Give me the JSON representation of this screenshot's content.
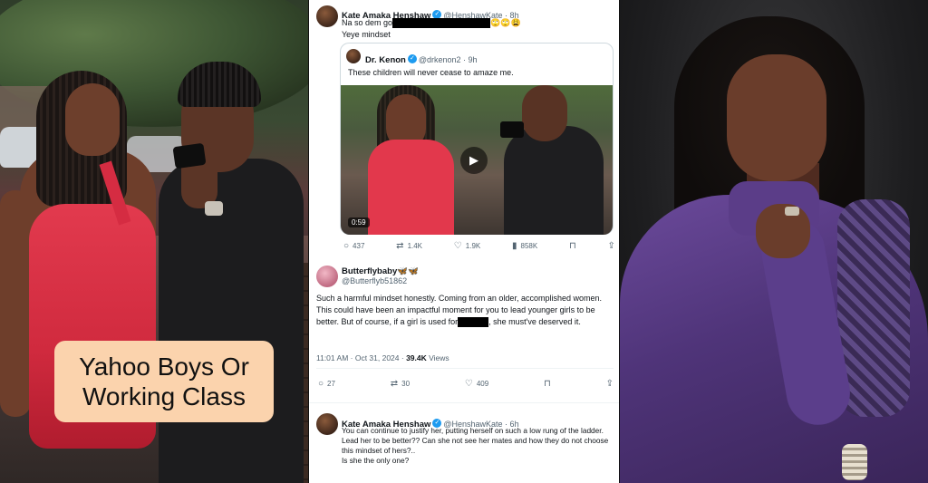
{
  "caption": {
    "line1": "Yahoo Boys Or",
    "line2": "Working Class",
    "background": "#fbd3ad"
  },
  "tweet1": {
    "name": "Kate Amaka Henshaw",
    "handle": "@HenshawKate · 8h",
    "text_prefix": "Na so dem go",
    "text_suffix": "🙄🙄😩",
    "line2": "Yeye mindset"
  },
  "quoted": {
    "name": "Dr. Kenon",
    "handle": "@drkenon2 · 9h",
    "text": "These children will never cease to amaze me.",
    "duration": "0:59",
    "replies": "437",
    "retweets": "1.4K",
    "likes": "1.9K",
    "views": "858K"
  },
  "tweet2": {
    "name": "Butterflybaby🦋🦋",
    "handle": "@Butterflyb51862",
    "text1": "Such a harmful mindset honestly. Coming from an older, accomplished women. This could have been an impactful moment for you to lead younger girls to be better. But of course, if a girl is used for",
    "text2": "she must've deserved it.",
    "time": "11:01 AM · Oct 31, 2024 · ",
    "views": "39.4K",
    "views_label": "Views",
    "replies": "27",
    "retweets": "30",
    "likes": "409"
  },
  "tweet3": {
    "name": "Kate Amaka Henshaw",
    "handle": "@HenshawKate · 6h",
    "line1": "You can continue to justify her, putting herself on such a low rung of the ladder.",
    "line2": "Lead her to be better?? Can she not see her mates and how they do not choose this mindset of hers?..",
    "line3": "Is she the only one?"
  },
  "colors": {
    "verified": "#1d9bf0",
    "text": "#0f1419",
    "muted": "#536471"
  }
}
